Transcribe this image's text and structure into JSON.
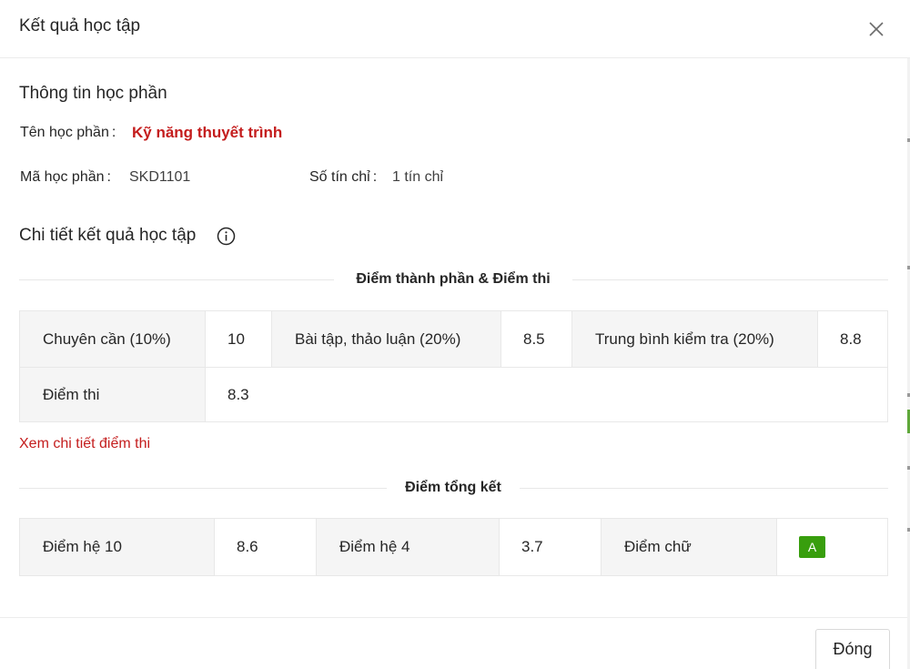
{
  "modal": {
    "title": "Kết quả học tập",
    "close_icon": "close-icon"
  },
  "course_info": {
    "heading": "Thông tin học phần",
    "name_label": "Tên học phần",
    "name_value": "Kỹ năng thuyết trình",
    "code_label": "Mã học phần",
    "code_value": "SKD1101",
    "credits_label": "Số tín chỉ",
    "credits_value": "1 tín chỉ",
    "colon": ":"
  },
  "details": {
    "heading": "Chi tiết kết quả học tập",
    "info_icon": "info-icon",
    "component_divider": "Điểm thành phần & Điểm thi",
    "components": [
      {
        "label": "Chuyên cần (10%)",
        "value": "10"
      },
      {
        "label": "Bài tập, thảo luận (20%)",
        "value": "8.5"
      },
      {
        "label": "Trung bình kiểm tra (20%)",
        "value": "8.8"
      },
      {
        "label": "Điểm thi",
        "value": "8.3"
      }
    ],
    "exam_detail_link": "Xem chi tiết điểm thi",
    "summary_divider": "Điểm tổng kết",
    "summary": [
      {
        "label": "Điểm hệ 10",
        "value": "8.6"
      },
      {
        "label": "Điểm hệ 4",
        "value": "3.7"
      },
      {
        "label": "Điểm chữ",
        "value": "A"
      }
    ]
  },
  "footer": {
    "close_button": "Đóng"
  },
  "colors": {
    "accent_red": "#c41d1d",
    "grade_green": "#389e0d",
    "label_bg": "#f5f5f5",
    "border": "#e8e8e8"
  }
}
